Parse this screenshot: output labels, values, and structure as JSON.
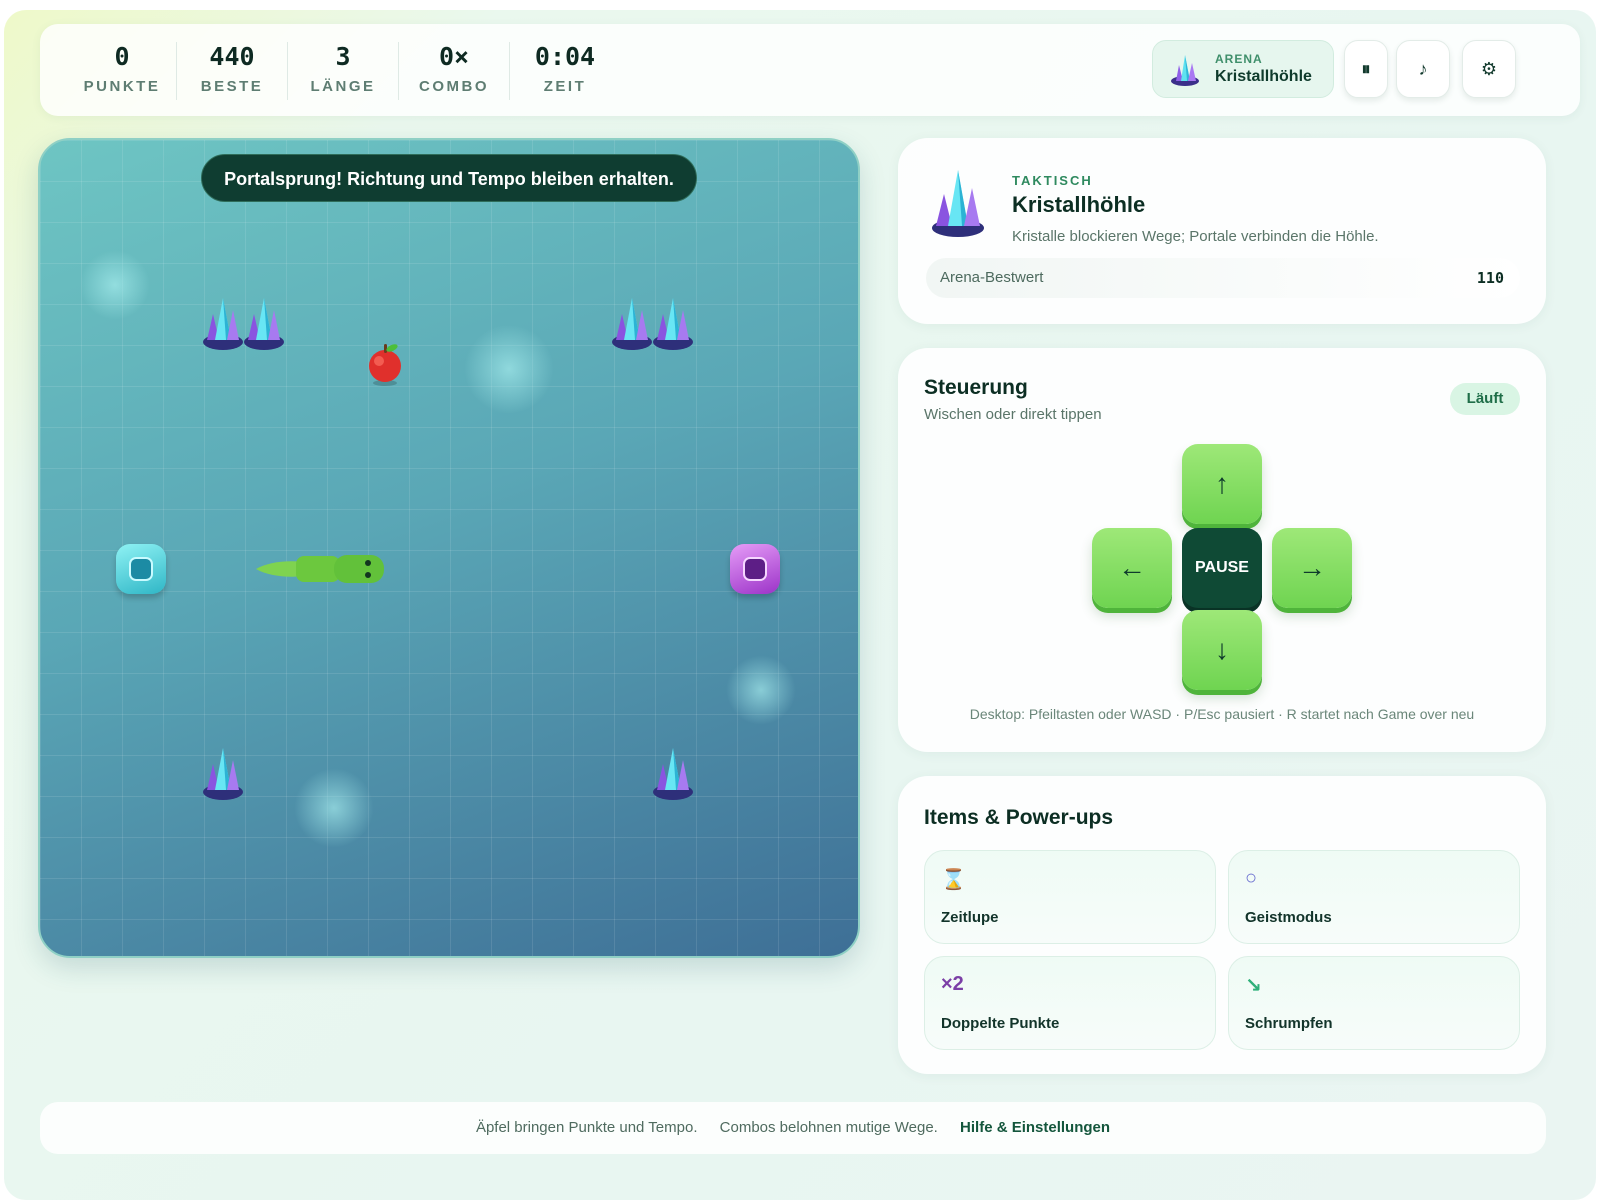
{
  "stats": [
    {
      "value": "0",
      "label": "PUNKTE"
    },
    {
      "value": "440",
      "label": "BESTE"
    },
    {
      "value": "3",
      "label": "LÄNGE"
    },
    {
      "value": "0×",
      "label": "COMBO"
    },
    {
      "value": "0:04",
      "label": "ZEIT"
    }
  ],
  "arena_chip": {
    "key": "ARENA",
    "value": "Kristallhöhle"
  },
  "toolbar": {
    "pause_icon": "⏸",
    "music_icon": "♪",
    "settings_icon": "⚙"
  },
  "board": {
    "toast": "Portalsprung! Richtung und Tempo bleiben erhalten.",
    "snake_length": 3,
    "portal_colors": {
      "a": "#2fb6c6",
      "b": "#9c33c8"
    }
  },
  "arena_card": {
    "eyebrow": "TAKTISCH",
    "title": "Kristallhöhle",
    "description": "Kristalle blockieren Wege; Portale verbinden die Höhle.",
    "best_label": "Arena-Bestwert",
    "best_value": "110"
  },
  "controls": {
    "title": "Steuerung",
    "subtitle": "Wischen oder direkt tippen",
    "status": "Läuft",
    "up": "↑",
    "down": "↓",
    "left": "←",
    "right": "→",
    "pause": "PAUSE",
    "hint": "Desktop: Pfeiltasten oder WASD · P/Esc pausiert · R startet nach Game over neu"
  },
  "items": {
    "title": "Items & Power-ups",
    "list": [
      {
        "icon": "⌛",
        "name": "Zeitlupe",
        "icon_color": "#7a4a1e"
      },
      {
        "icon": "○",
        "name": "Geistmodus",
        "icon_color": "#6a6fd0"
      },
      {
        "icon": "×2",
        "name": "Doppelte Punkte",
        "icon_color": "#7b3fa6"
      },
      {
        "icon": "↘",
        "name": "Schrumpfen",
        "icon_color": "#2fb07a"
      }
    ]
  },
  "footer": {
    "tip1": "Äpfel bringen Punkte und Tempo.",
    "tip2": "Combos belohnen mutige Wege.",
    "link": "Hilfe & Einstellungen"
  }
}
